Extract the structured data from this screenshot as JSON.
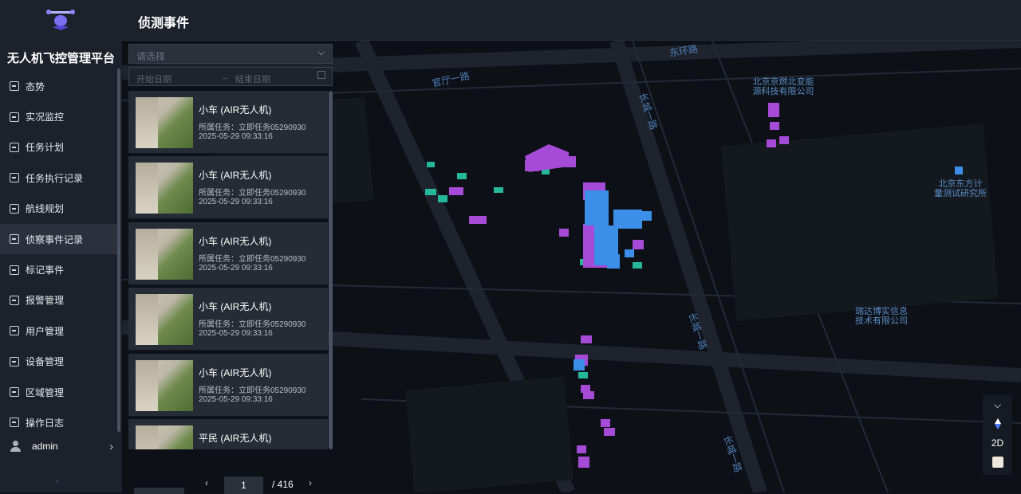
{
  "app": {
    "platform_title": "无人机飞控管理平台",
    "page_title": "侦测事件"
  },
  "sidebar": {
    "items": [
      {
        "label": "态势",
        "icon": "chart-icon"
      },
      {
        "label": "实况监控",
        "icon": "monitor-icon"
      },
      {
        "label": "任务计划",
        "icon": "edit-icon"
      },
      {
        "label": "任务执行记录",
        "icon": "list-icon"
      },
      {
        "label": "航线规划",
        "icon": "route-icon"
      },
      {
        "label": "侦察事件记录",
        "icon": "search-doc-icon",
        "active": true
      },
      {
        "label": "标记事件",
        "icon": "mark-icon"
      },
      {
        "label": "报警管理",
        "icon": "alarm-icon"
      },
      {
        "label": "用户管理",
        "icon": "user-icon"
      },
      {
        "label": "设备管理",
        "icon": "device-icon"
      },
      {
        "label": "区域管理",
        "icon": "area-icon"
      },
      {
        "label": "操作日志",
        "icon": "log-icon"
      }
    ],
    "user": {
      "name": "admin"
    }
  },
  "filters": {
    "select_placeholder": "请选择",
    "start_date_placeholder": "开始日期",
    "range_separator": "→",
    "end_date_placeholder": "结束日期"
  },
  "events": [
    {
      "title": "小车 (AIR无人机)",
      "task": "所属任务：立即任务05290930",
      "time": "2025-05-29 09:33:16"
    },
    {
      "title": "小车 (AIR无人机)",
      "task": "所属任务：立即任务05290930",
      "time": "2025-05-29 09:33:16"
    },
    {
      "title": "小车 (AIR无人机)",
      "task": "所属任务：立即任务05290930",
      "time": "2025-05-29 09:33:16"
    },
    {
      "title": "小车 (AIR无人机)",
      "task": "所属任务：立即任务05290930",
      "time": "2025-05-29 09:33:16"
    },
    {
      "title": "小车 (AIR无人机)",
      "task": "所属任务：立即任务05290930",
      "time": "2025-05-29 09:33:16"
    },
    {
      "title": "平民 (AIR无人机)",
      "task": "",
      "time": ""
    }
  ],
  "pagination": {
    "current": "1",
    "total": "/ 416"
  },
  "map": {
    "roads": [
      "官厅一路",
      "东环路",
      "长城一路",
      "长城一路",
      "长城一路"
    ],
    "pois": [
      "北京京燃北变能\n源科技有限公司",
      "北京东方计\n量测试研究所",
      "瑞达博实信息\n技术有限公司"
    ],
    "controls": {
      "mode": "2D"
    },
    "colors": {
      "purple": "#a64bd8",
      "blue": "#3b8fe8",
      "teal": "#25b89a"
    }
  }
}
